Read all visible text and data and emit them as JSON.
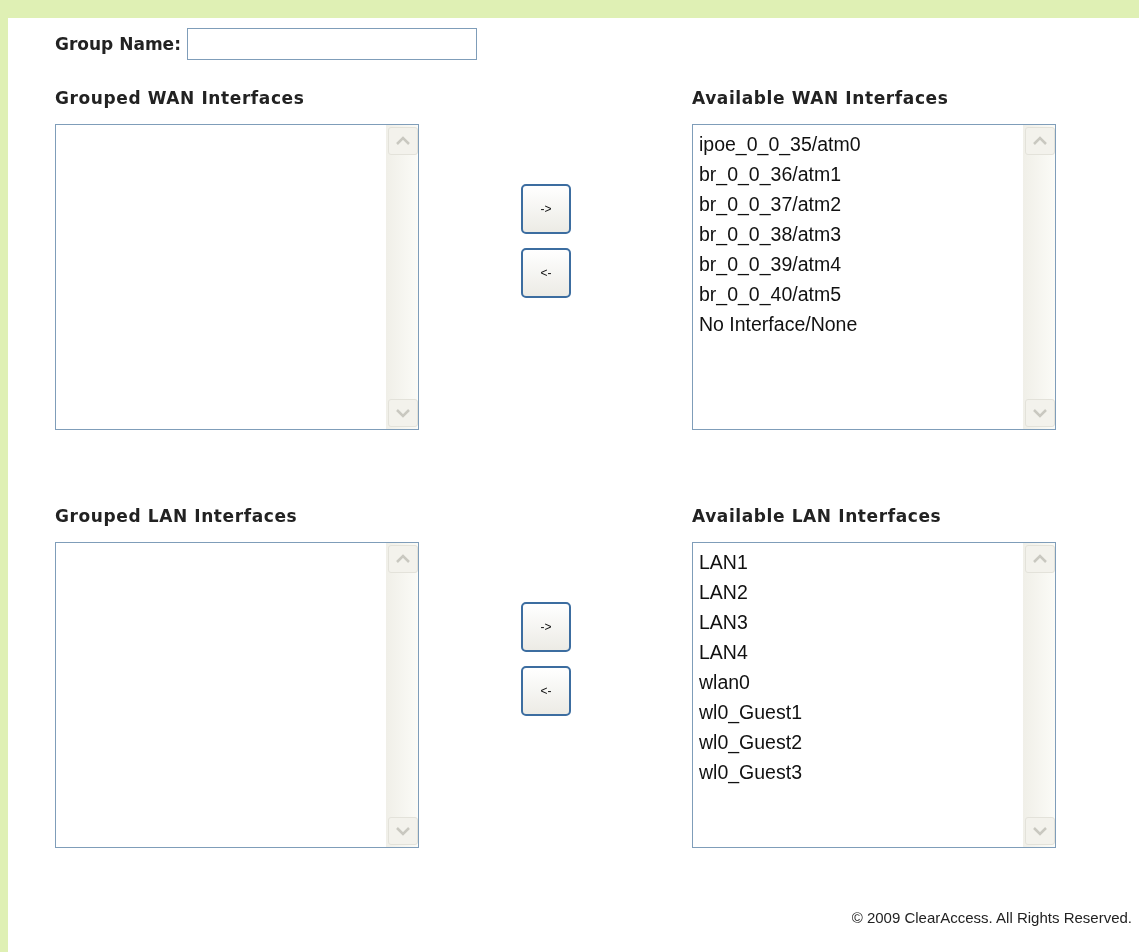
{
  "group_name": {
    "label": "Group Name:"
  },
  "sections": [
    {
      "grouped": {
        "heading": "Grouped WAN Interfaces"
      },
      "available": {
        "heading": "Available WAN Interfaces",
        "items": [
          "ipoe_0_0_35/atm0",
          "br_0_0_36/atm1",
          "br_0_0_37/atm2",
          "br_0_0_38/atm3",
          "br_0_0_39/atm4",
          "br_0_0_40/atm5",
          "No Interface/None"
        ]
      },
      "buttons": [
        "->",
        "<-"
      ]
    },
    {
      "grouped": {
        "heading": "Grouped LAN Interfaces"
      },
      "available": {
        "heading": "Available LAN Interfaces",
        "items": [
          "LAN1",
          "LAN2",
          "LAN3",
          "LAN4",
          "wlan0",
          "wl0_Guest1",
          "wl0_Guest2",
          "wl0_Guest3"
        ]
      },
      "buttons": [
        "->",
        "<-"
      ]
    }
  ],
  "footer": "© 2009 ClearAccess. All Rights Reserved."
}
